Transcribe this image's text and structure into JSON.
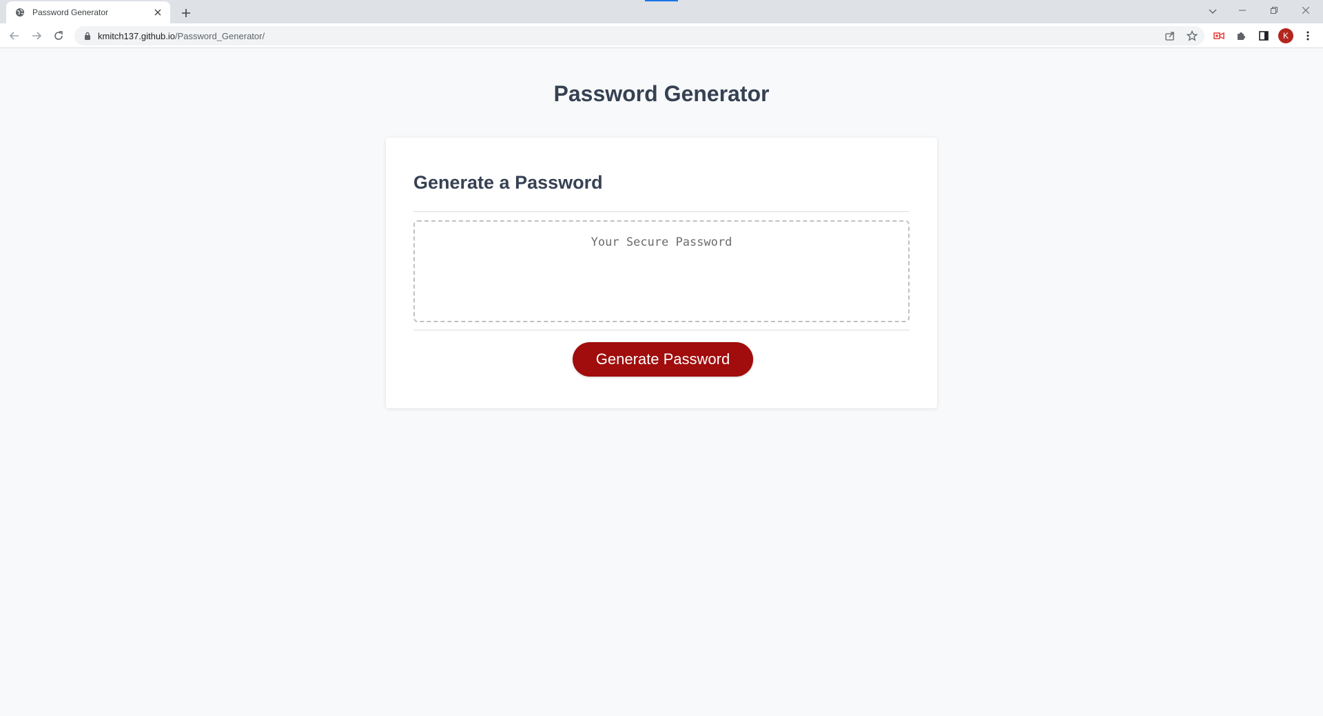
{
  "browser": {
    "tab": {
      "title": "Password Generator",
      "favicon": "globe-icon"
    },
    "address": {
      "host": "kmitch137.github.io",
      "path": "/Password_Generator/"
    },
    "profile_initial": "K",
    "colors": {
      "tabstrip": "#dee1e6",
      "toolbar": "#ffffff",
      "omnibox": "#f1f3f4",
      "avatar": "#b3261e"
    }
  },
  "page": {
    "title": "Password Generator",
    "card": {
      "header": "Generate a Password",
      "password_placeholder": "Your Secure Password",
      "password_value": "",
      "button_label": "Generate Password"
    },
    "colors": {
      "background": "#f8f9fb",
      "heading": "#364152",
      "button": "#a10c0c"
    }
  }
}
